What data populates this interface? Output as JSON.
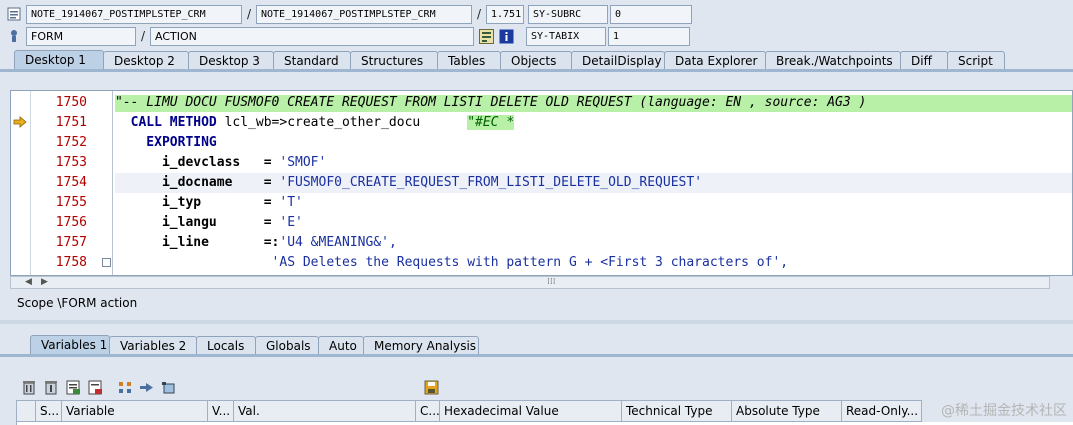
{
  "header": {
    "program1": "NOTE_1914067_POSTIMPLSTEP_CRM",
    "program2": "NOTE_1914067_POSTIMPLSTEP_CRM",
    "line_pos": "1.751",
    "sysfield1": "SY-SUBRC",
    "sysvalue1": "0",
    "event_type": "FORM",
    "event_name": "ACTION",
    "sysfield2": "SY-TABIX",
    "sysvalue2": "1"
  },
  "tabs": [
    "Desktop 1",
    "Desktop 2",
    "Desktop 3",
    "Standard",
    "Structures",
    "Tables",
    "Objects",
    "DetailDisplay",
    "Data Explorer",
    "Break./Watchpoints",
    "Diff",
    "Script"
  ],
  "active_tab": "Desktop 1",
  "code": {
    "lines": [
      {
        "num": "1750",
        "text": "\"-- LIMU DOCU FUSMOF0 CREATE REQUEST FROM LISTI DELETE OLD REQUEST (language: EN , source: AG3 )"
      },
      {
        "num": "1751",
        "part1": "  CALL METHOD",
        "part2": " lcl_wb=>create_other_docu      ",
        "part3": "\"#EC *"
      },
      {
        "num": "1752",
        "text": "    EXPORTING"
      },
      {
        "num": "1753",
        "part1": "      i_devclass   = ",
        "part2": "'SMOF'"
      },
      {
        "num": "1754",
        "part1": "      i_docname    = ",
        "part2": "'FUSMOF0_CREATE_REQUEST_FROM_LISTI_DELETE_OLD_REQUEST'"
      },
      {
        "num": "1755",
        "part1": "      i_typ        = ",
        "part2": "'T'"
      },
      {
        "num": "1756",
        "part1": "      i_langu      = ",
        "part2": "'E'"
      },
      {
        "num": "1757",
        "part1": "      i_line       =:",
        "part2": "'U4 &MEANING&',"
      },
      {
        "num": "1758",
        "part1": "                    ",
        "part2": "'AS Deletes the Requests with pattern G + <First 3 characters of',"
      }
    ]
  },
  "scope": "Scope \\FORM action",
  "var_tabs": [
    "Variables 1",
    "Variables 2",
    "Locals",
    "Globals",
    "Auto",
    "Memory Analysis"
  ],
  "active_var_tab": "Variables 1",
  "grid_columns": [
    "S...",
    "Variable",
    "V...",
    "Val.",
    "C...",
    "Hexadecimal Value",
    "Technical Type",
    "Absolute Type",
    "Read-Only..."
  ],
  "watermark": "@稀土掘金技术社区",
  "colors": {
    "accent": "#bcd0e6",
    "comment_bg": "#b8f0a8",
    "line_number": "#b00000"
  }
}
